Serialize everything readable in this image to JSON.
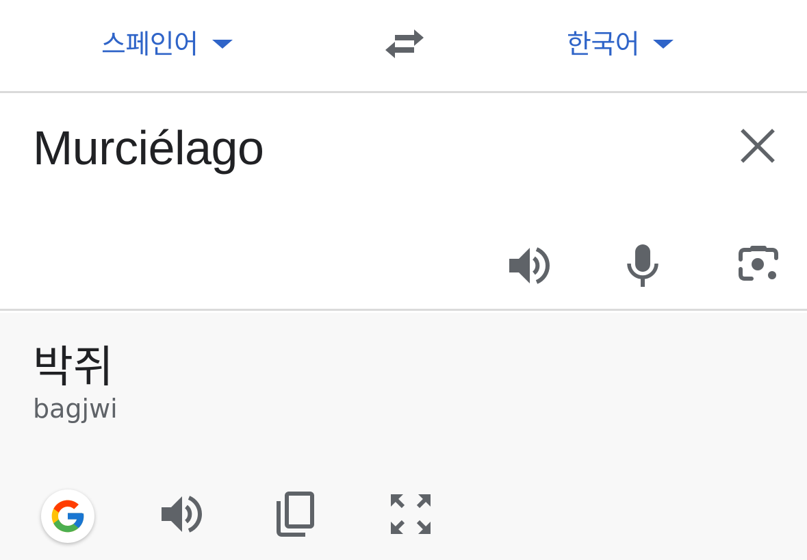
{
  "language_bar": {
    "source_language": "스페인어",
    "target_language": "한국어"
  },
  "input": {
    "source_text": "Murciélago"
  },
  "output": {
    "translation": "박쥐",
    "romanization": "bagjwi"
  },
  "icons": {
    "source_dropdown": "chevron-down-icon",
    "target_dropdown": "chevron-down-icon",
    "swap": "swap-icon",
    "clear": "close-icon",
    "input_speaker": "speaker-icon",
    "microphone": "microphone-icon",
    "camera": "camera-icon",
    "google": "google-logo-icon",
    "output_speaker": "speaker-icon",
    "copy": "copy-icon",
    "fullscreen": "fullscreen-icon"
  },
  "colors": {
    "accent": "#2f64c8",
    "icon_gray": "#5f6368",
    "text": "#202124",
    "output_background": "#f8f8f8",
    "divider": "#dadada"
  }
}
